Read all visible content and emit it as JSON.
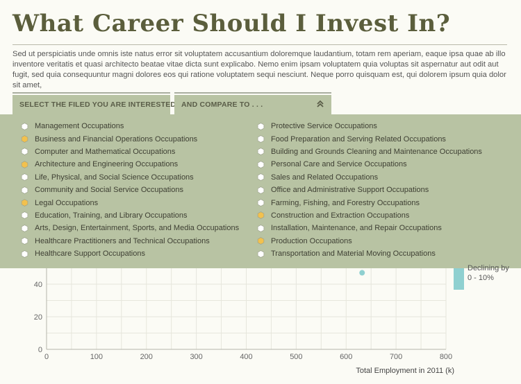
{
  "header": {
    "title": "What Career Should I Invest In?",
    "intro": "Sed ut perspiciatis unde omnis iste natus error sit voluptatem accusantium doloremque laudantium, totam rem aperiam, eaque ipsa quae ab illo inventore veritatis et quasi architecto beatae vitae dicta sunt explicabo. Nemo enim ipsam voluptatem quia voluptas sit aspernatur aut odit aut fugit, sed quia consequuntur magni dolores eos qui ratione voluptatem sequi nesciunt. Neque porro quisquam est, qui dolorem ipsum quia dolor sit amet,"
  },
  "selectors": {
    "field_label": "SELECT THE FILED YOU ARE INTERESTED IN",
    "compare_label": "AND COMPARE TO . . ."
  },
  "colors": {
    "selected": "#f2c14e",
    "unselected": "#ffffff",
    "panel": "#b8c3a3",
    "accent": "#8fd0d0"
  },
  "options": {
    "left": [
      {
        "label": "Management Occupations",
        "selected": false
      },
      {
        "label": "Business and Financial Operations Occupations",
        "selected": true
      },
      {
        "label": "Computer and Mathematical Occupations",
        "selected": false
      },
      {
        "label": "Architecture and Engineering Occupations",
        "selected": true
      },
      {
        "label": "Life, Physical, and Social Science Occupations",
        "selected": false
      },
      {
        "label": "Community and Social Service Occupations",
        "selected": false
      },
      {
        "label": "Legal Occupations",
        "selected": true
      },
      {
        "label": "Education, Training, and Library Occupations",
        "selected": false
      },
      {
        "label": "Arts, Design, Entertainment, Sports, and Media Occupations",
        "selected": false
      },
      {
        "label": "Healthcare Practitioners and Technical Occupations",
        "selected": false
      },
      {
        "label": "Healthcare Support Occupations",
        "selected": false
      }
    ],
    "right": [
      {
        "label": "Protective Service Occupations",
        "selected": false
      },
      {
        "label": "Food Preparation and Serving Related Occupations",
        "selected": false
      },
      {
        "label": "Building and Grounds Cleaning and Maintenance Occupations",
        "selected": false
      },
      {
        "label": "Personal Care and Service Occupations",
        "selected": false
      },
      {
        "label": "Sales and Related Occupations",
        "selected": false
      },
      {
        "label": "Office and Administrative Support Occupations",
        "selected": false
      },
      {
        "label": "Farming, Fishing, and Forestry Occupations",
        "selected": false
      },
      {
        "label": "Construction and Extraction Occupations",
        "selected": true
      },
      {
        "label": "Installation, Maintenance, and Repair Occupations",
        "selected": false
      },
      {
        "label": "Production Occupations",
        "selected": true
      },
      {
        "label": "Transportation and Material Moving Occupations",
        "selected": false
      }
    ]
  },
  "legend": {
    "line1": "Declining by",
    "line2": "0 - 10%"
  },
  "chart_data": {
    "type": "scatter",
    "xlabel": "Total Employment in 2011 (k)",
    "ylabel": "",
    "xlim": [
      0,
      800
    ],
    "ylim": [
      0,
      50
    ],
    "x_ticks": [
      0,
      100,
      200,
      300,
      400,
      500,
      600,
      700,
      800
    ],
    "y_ticks": [
      0,
      20,
      40
    ],
    "grid": true,
    "points": [
      {
        "x": 632,
        "y": 47
      }
    ]
  }
}
